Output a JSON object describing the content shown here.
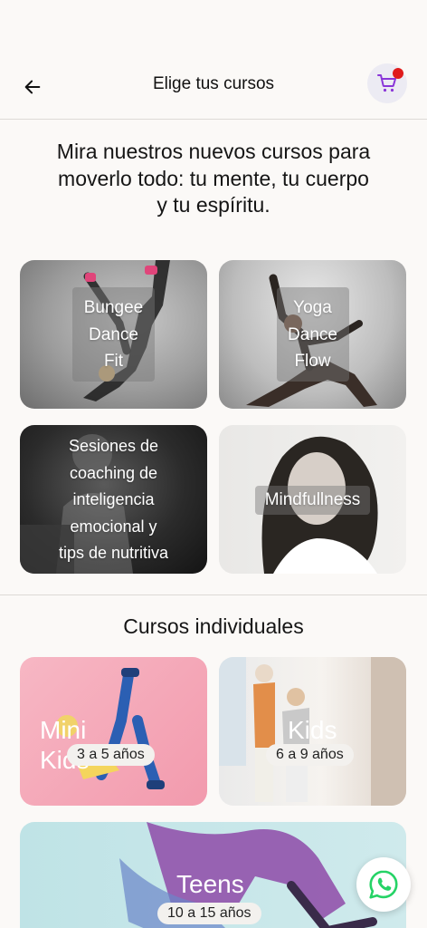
{
  "header": {
    "title": "Elige tus cursos",
    "back_icon": "arrow-left-icon",
    "cart_icon": "shopping-cart-icon"
  },
  "intro": {
    "text": "Mira nuestros nuevos cursos para moverlo todo: tu mente, tu cuerpo y tu espíritu."
  },
  "featured_courses": [
    {
      "lines": [
        "Bungee",
        "Dance",
        "Fit"
      ]
    },
    {
      "lines": [
        "Yoga",
        "Dance",
        "Flow"
      ]
    },
    {
      "lines": [
        "Sesiones de",
        "coaching de",
        "inteligencia",
        "emocional y",
        "tips de nutritiva"
      ]
    },
    {
      "lines": [
        "Mindfullness"
      ]
    }
  ],
  "individual": {
    "title": "Cursos individuales",
    "courses": [
      {
        "name_lines": [
          "Mini",
          "Kids"
        ],
        "age": "3 a 5 años"
      },
      {
        "name_lines": [
          "Kids"
        ],
        "age": "6 a 9 años"
      },
      {
        "name_lines": [
          "Teens"
        ],
        "age": "10 a 15 años"
      }
    ]
  },
  "colors": {
    "cart_badge": "#e01b1b",
    "cart_icon": "#8a36d8",
    "whatsapp": "#25d366"
  },
  "fab": {
    "icon": "whatsapp-icon"
  }
}
